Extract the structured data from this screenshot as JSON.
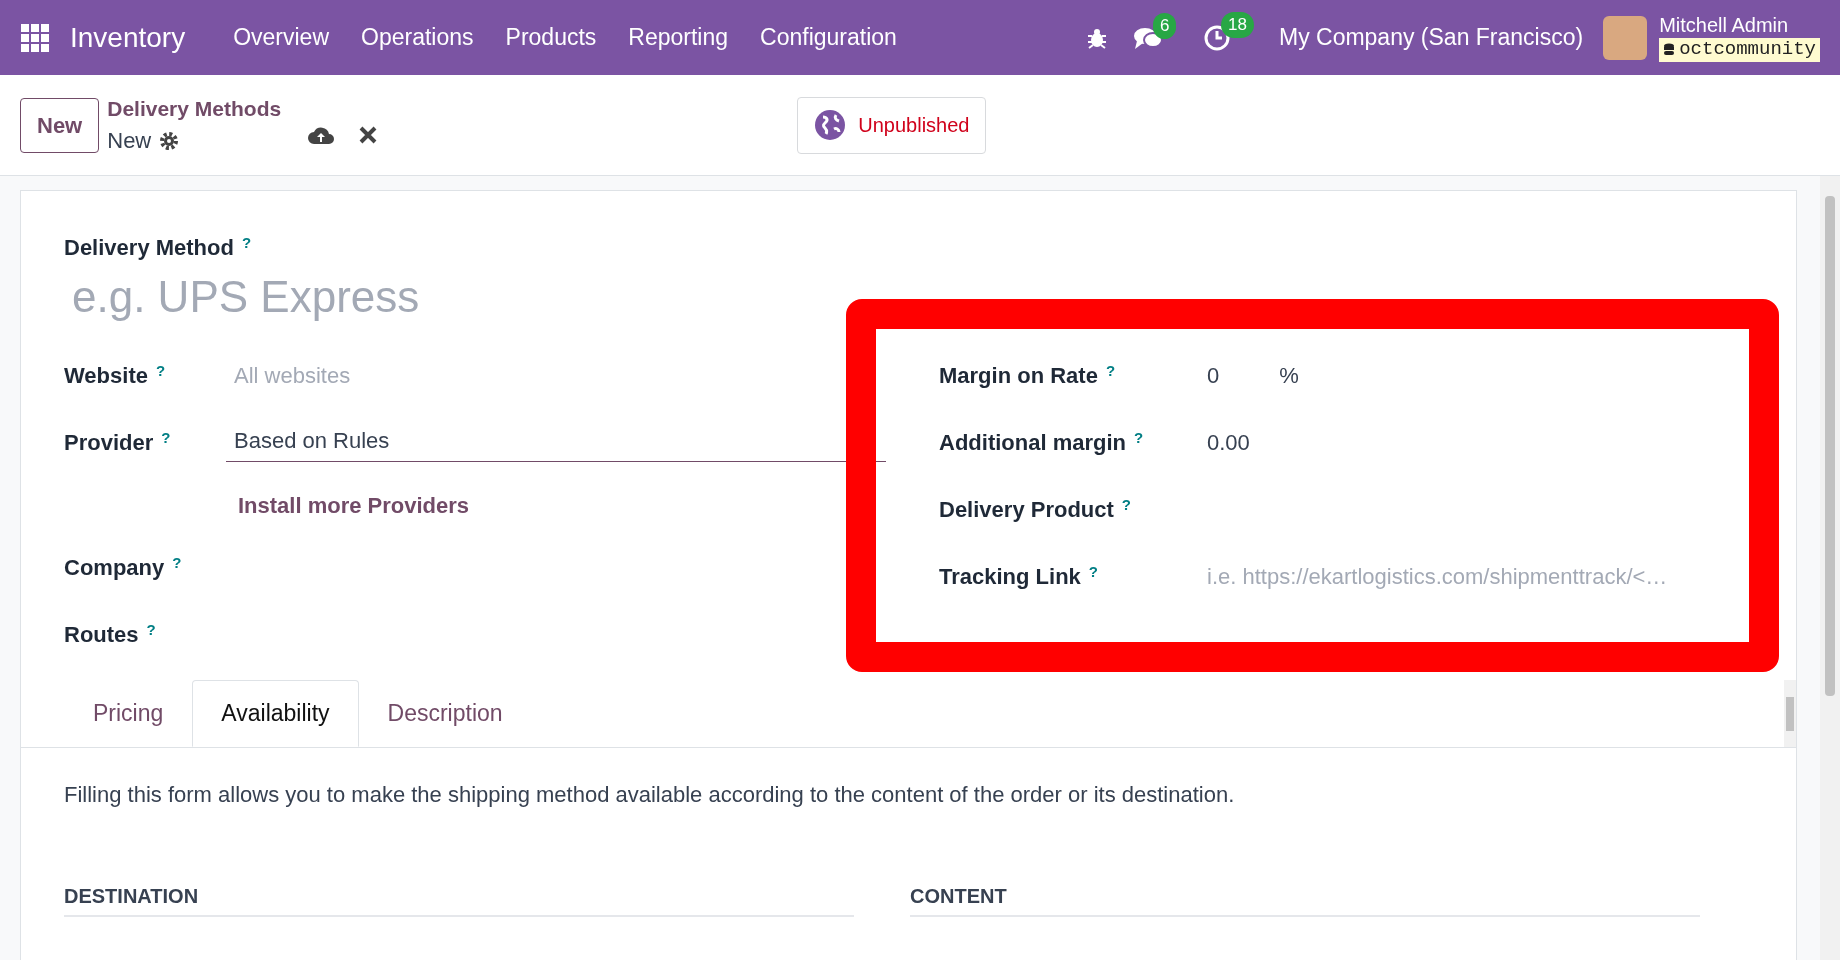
{
  "navbar": {
    "app_name": "Inventory",
    "menu": [
      "Overview",
      "Operations",
      "Products",
      "Reporting",
      "Configuration"
    ],
    "messages_count": "6",
    "activities_count": "18",
    "company": "My Company (San Francisco)",
    "user": "Mitchell Admin",
    "database": "octcommunity"
  },
  "control_panel": {
    "new_button": "New",
    "breadcrumb": "Delivery Methods",
    "record": "New",
    "website_status": "Unpublished"
  },
  "form": {
    "name_label": "Delivery Method",
    "name_help": "?",
    "name_placeholder": "e.g. UPS Express",
    "left_fields": [
      {
        "label": "Website",
        "help": "?",
        "kind": "placeholder",
        "text": "All websites"
      },
      {
        "label": "Provider",
        "help": "?",
        "kind": "select",
        "text": "Based on Rules"
      },
      {
        "label": "Company",
        "help": "?",
        "kind": "empty"
      },
      {
        "label": "Routes",
        "help": "?",
        "kind": "empty"
      }
    ],
    "provider_link": "Install more Providers",
    "right_fields": [
      {
        "label": "Margin on Rate",
        "help": "?",
        "kind": "value",
        "text": "0",
        "suffix": "%"
      },
      {
        "label": "Additional margin",
        "help": "?",
        "kind": "value",
        "text": "0.00"
      },
      {
        "label": "Delivery Product",
        "help": "?",
        "kind": "empty"
      },
      {
        "label": "Tracking Link",
        "help": "?",
        "kind": "placeholder",
        "text": "i.e. https://ekartlogistics.com/shipmenttrack/<…"
      }
    ],
    "tabs": [
      {
        "label": "Pricing",
        "selected": false
      },
      {
        "label": "Availability",
        "selected": true
      },
      {
        "label": "Description",
        "selected": false
      }
    ],
    "note": "Filling this form allows you to make the shipping method available according to the content of the order or its destination.",
    "sections": [
      "DESTINATION",
      "CONTENT"
    ]
  }
}
